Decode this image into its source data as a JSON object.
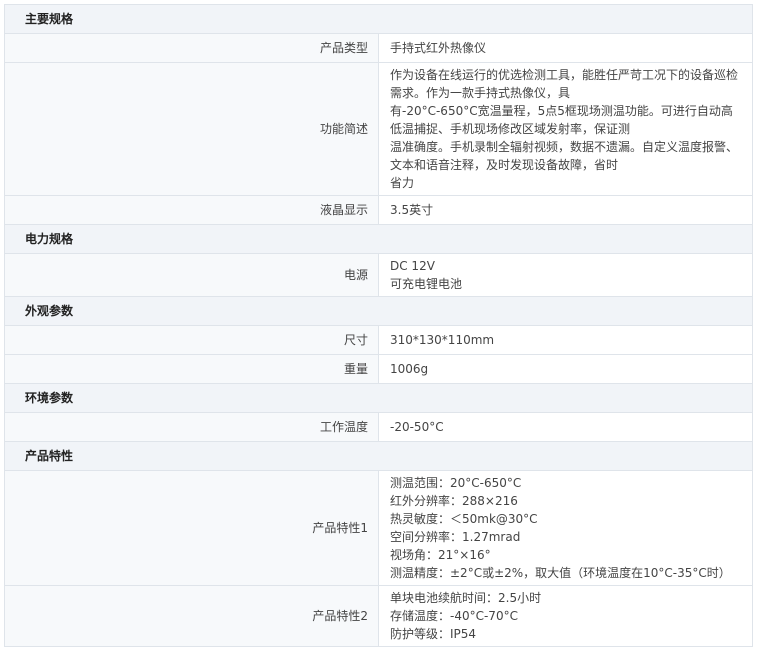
{
  "sections": [
    {
      "title": "主要规格",
      "rows": [
        {
          "label": "产品类型",
          "lines": [
            "手持式红外热像仪"
          ]
        },
        {
          "label": "功能简述",
          "lines": [
            "作为设备在线运行的优选检测工具，能胜任严苛工况下的设备巡检需求。作为一款手持式热像仪，具",
            "有-20°C-650°C宽温量程，5点5框现场测温功能。可进行自动高低温捕捉、手机现场修改区域发射率，保证测",
            "温准确度。手机录制全辐射视频，数据不遗漏。自定义温度报警、文本和语音注释，及时发现设备故障，省时",
            "省力"
          ]
        },
        {
          "label": "液晶显示",
          "lines": [
            "3.5英寸"
          ]
        }
      ]
    },
    {
      "title": "电力规格",
      "rows": [
        {
          "label": "电源",
          "lines": [
            "DC 12V",
            "可充电锂电池"
          ]
        }
      ]
    },
    {
      "title": "外观参数",
      "rows": [
        {
          "label": "尺寸",
          "lines": [
            "310*130*110mm"
          ]
        },
        {
          "label": "重量",
          "lines": [
            "1006g"
          ]
        }
      ]
    },
    {
      "title": "环境参数",
      "rows": [
        {
          "label": "工作温度",
          "lines": [
            "-20-50°C"
          ]
        }
      ]
    },
    {
      "title": "产品特性",
      "rows": [
        {
          "label": "产品特性1",
          "lines": [
            "测温范围：20°C-650°C",
            "红外分辨率：288×216",
            "热灵敏度：＜50mk@30°C",
            "空间分辨率：1.27mrad",
            "视场角：21°×16°",
            "测温精度：±2°C或±2%，取大值（环境温度在10°C-35°C时）"
          ]
        },
        {
          "label": "产品特性2",
          "lines": [
            "单块电池续航时间：2.5小时",
            "存储温度：-40°C-70°C",
            "防护等级：IP54"
          ]
        }
      ]
    }
  ]
}
